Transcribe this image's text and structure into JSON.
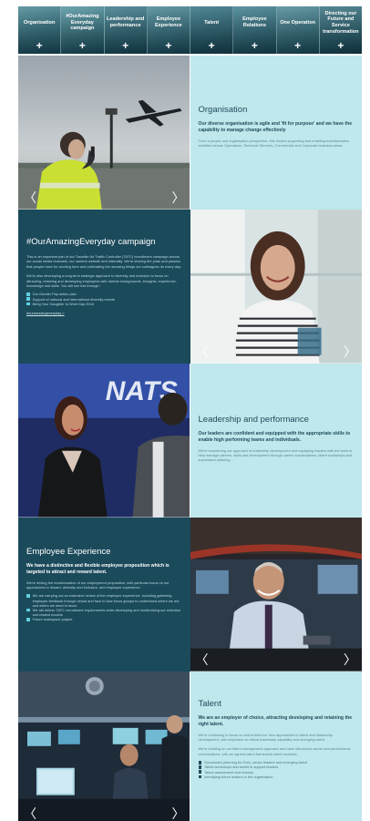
{
  "nav": {
    "items": [
      {
        "label": "Organisation",
        "plus": "+"
      },
      {
        "label": "#OurAmazing Everyday campaign",
        "plus": "+"
      },
      {
        "label": "Leadership and performance",
        "plus": "+"
      },
      {
        "label": "Employee Experience",
        "plus": "+"
      },
      {
        "label": "Talent",
        "plus": "+"
      },
      {
        "label": "Employee Relations",
        "plus": "+"
      },
      {
        "label": "One Operation",
        "plus": "+"
      },
      {
        "label": "Directing our Future and Service transformation",
        "plus": "+"
      }
    ]
  },
  "carousel": {
    "prev": "〈",
    "next": "〉"
  },
  "organisation": {
    "title": "Organisation",
    "lead": "Our diverse organisation is agile and 'fit for purpose' and we have the capability to manage change effectively",
    "body": "From a people and organisation perspective, this means supporting and enabling transformation activities across Operations, Technical Services, Commercial and Corporate business areas."
  },
  "campaign": {
    "title": "#OurAmazingEveryday campaign",
    "body1": "This is an important part of our Traveller Air Traffic Controller (TATC) recruitment campaign across our social media channels, our careers website and internally. We're sharing the pride and passion that people have for working here and celebrating the amazing things our colleagues do every day.",
    "body2": "We're also developing a long-term strategic approach to diversity and inclusion to focus on attracting, retaining and developing employees with diverse backgrounds, thoughts, experience, knowledge and skills. You will see this through:",
    "bullets": [
      "Our Gender Pay action plan",
      "Support of national and international diversity events",
      "Bring Your Daughter to Work Day 2018"
    ],
    "link": "#ouramazingeveryday >"
  },
  "leadership": {
    "title": "Leadership and performance",
    "lead": "Our leaders are confident and equipped with the appropriate skills to enable high performing teams and individuals.",
    "body": "We're broadening our approach to leadership development and equipping leaders with the tools to help manage careers, skills and development through career conversations, talent workshops and succession planning."
  },
  "experience": {
    "title": "Employee Experience",
    "lead": "We have a distinctive and flexible employee proposition which is targeted to attract and reward talent.",
    "body": "We're driving the modernisation of our employment proposition, with particular focus on our approaches to reward, diversity and inclusion, and employee experience:",
    "bullets": [
      "We are carrying out an extensive review of the employee experience, including gathering employee feedback through virtual and face to face focus groups to understand where we are and where we need to focus",
      "We will deliver TATC recruitment requirements while developing and modernising our selection and reward models",
      "Future workspace project"
    ]
  },
  "talent": {
    "title": "Talent",
    "lead": "We are an employer of choice, attracting developing and retaining the right talent.",
    "body1": "We're continuing to focus on and embed our new approaches to talent and leadership development, with emphasis on critical leadership capability and emerging talent.",
    "body2": "We're building on our talent management approach and have introduced career and performance conversations, with an agreed talent framework which includes:",
    "bullets": [
      "Succession planning for Exec, senior leaders and emerging talent",
      "Talent workshops and toolkit to support leaders",
      "Talent assessment and reviews",
      "Identifying future leaders in the organisation"
    ]
  },
  "images": {
    "nats_sign": "NATS"
  }
}
